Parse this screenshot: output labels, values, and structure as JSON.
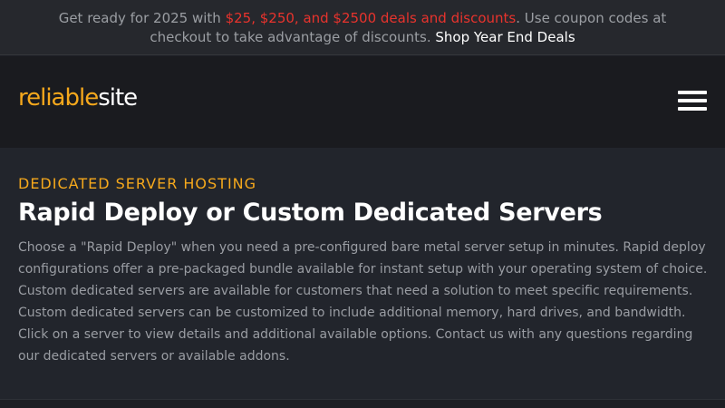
{
  "promo": {
    "prefix": "Get ready for 2025 with ",
    "highlight": "$25, $250, and $2500 deals and discounts",
    "middle": ". Use coupon codes at checkout to take advantage of discounts. ",
    "link": "Shop Year End Deals"
  },
  "header": {
    "logo_part_1": "reliable",
    "logo_part_2": "site",
    "menu_icon": "hamburger-menu-icon"
  },
  "hero": {
    "eyebrow": "DEDICATED SERVER HOSTING",
    "title": "Rapid Deploy or Custom Dedicated Servers",
    "description": "Choose a \"Rapid Deploy\" when you need a pre-configured bare metal server setup in minutes. Rapid deploy configurations offer a pre-packaged bundle available for instant setup with your operating system of choice. Custom dedicated servers are available for customers that need a solution to meet specific requirements. Custom dedicated servers can be customized to include additional memory, hard drives, and bandwidth. Click on a server to view details and additional available options. Contact us with any questions regarding our dedicated servers or available addons."
  },
  "colors": {
    "accent": "#f5a81c",
    "promo_highlight": "#e8332d",
    "background": "#22252c",
    "header_background": "#1a1b1f"
  }
}
